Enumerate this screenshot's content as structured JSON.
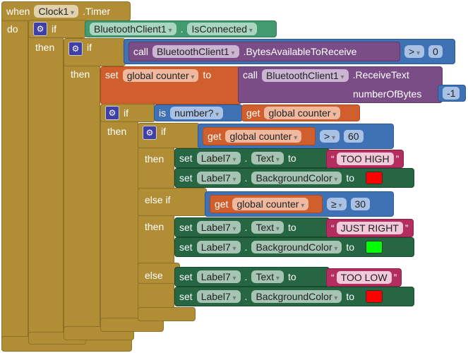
{
  "event": {
    "when": "when",
    "component": "Clock1",
    "event": ".Timer",
    "do": "do"
  },
  "kw": {
    "if": "if",
    "then": "then",
    "else_if": "else if",
    "else": "else",
    "set": "set",
    "to": "to",
    "call": "call",
    "get": "get",
    "is": "is",
    "dot": "."
  },
  "if1": {
    "component": "BluetoothClient1",
    "property": "IsConnected"
  },
  "if2": {
    "component": "BluetoothClient1",
    "method": ".BytesAvailableToReceive",
    "op": ">",
    "value": "0"
  },
  "set_counter": {
    "variable": "global counter",
    "component": "BluetoothClient1",
    "method": ".ReceiveText",
    "param": "numberOfBytes",
    "value": "-1"
  },
  "if3": {
    "test": "number?",
    "variable": "global counter"
  },
  "branches": [
    {
      "variable": "global counter",
      "op": ">",
      "value": "60",
      "text": "TOO HIGH",
      "color": "#ff0000"
    },
    {
      "variable": "global counter",
      "op": "≥",
      "value": "30",
      "text": "JUST RIGHT",
      "color": "#00ff00"
    },
    {
      "text": "TOO LOW",
      "color": "#ff0000"
    }
  ],
  "label": {
    "component": "Label7",
    "text_prop": "Text",
    "bg_prop": "BackgroundColor"
  },
  "colors": {
    "control": "#b18e35",
    "component": "#439970",
    "math": "#3f71b5",
    "procedure": "#7a4d87",
    "variable": "#d05f2d",
    "setter": "#266643",
    "text": "#b32d5e"
  }
}
